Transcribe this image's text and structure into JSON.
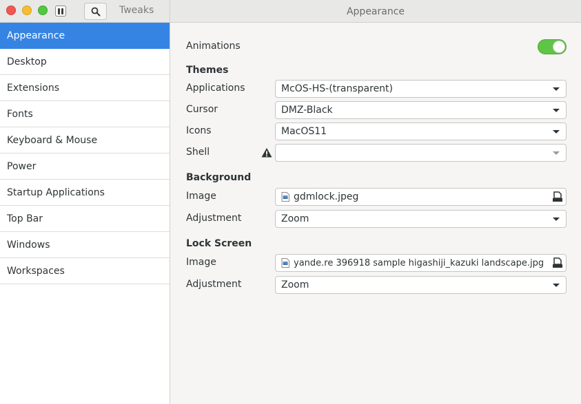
{
  "window": {
    "app_title": "Tweaks",
    "page_title": "Appearance",
    "colors": {
      "accent": "#3584e4",
      "switch_on": "#5ec546"
    }
  },
  "sidebar": {
    "items": [
      {
        "label": "Appearance",
        "active": true
      },
      {
        "label": "Desktop"
      },
      {
        "label": "Extensions"
      },
      {
        "label": "Fonts"
      },
      {
        "label": "Keyboard & Mouse"
      },
      {
        "label": "Power"
      },
      {
        "label": "Startup Applications"
      },
      {
        "label": "Top Bar"
      },
      {
        "label": "Windows"
      },
      {
        "label": "Workspaces"
      }
    ]
  },
  "main": {
    "animations": {
      "label": "Animations",
      "enabled": true
    },
    "themes": {
      "heading": "Themes",
      "applications": {
        "label": "Applications",
        "value": "McOS-HS-(transparent)"
      },
      "cursor": {
        "label": "Cursor",
        "value": "DMZ-Black"
      },
      "icons": {
        "label": "Icons",
        "value": "MacOS11"
      },
      "shell": {
        "label": "Shell",
        "value": "",
        "warning_icon": "warning-icon"
      }
    },
    "background": {
      "heading": "Background",
      "image": {
        "label": "Image",
        "value": "gdmlock.jpeg"
      },
      "adjustment": {
        "label": "Adjustment",
        "value": "Zoom"
      }
    },
    "lock_screen": {
      "heading": "Lock Screen",
      "image": {
        "label": "Image",
        "value": "yande.re 396918 sample higashiji_kazuki landscape.jpg"
      },
      "adjustment": {
        "label": "Adjustment",
        "value": "Zoom"
      }
    }
  }
}
